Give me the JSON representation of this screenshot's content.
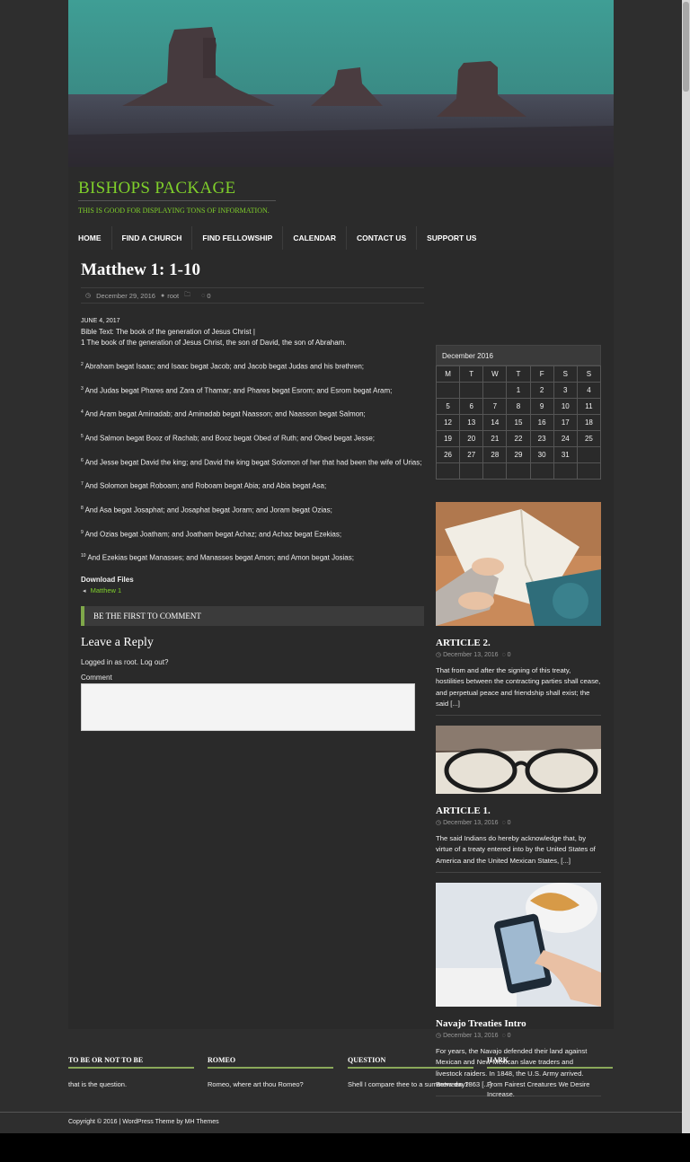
{
  "site": {
    "title": "BISHOPS PACKAGE",
    "tagline": "THIS IS GOOD FOR DISPLAYING TONS OF INFORMATION."
  },
  "nav": {
    "items": [
      {
        "label": "HOME"
      },
      {
        "label": "FIND A CHURCH"
      },
      {
        "label": "FIND FELLOWSHIP"
      },
      {
        "label": "CALENDAR"
      },
      {
        "label": "CONTACT US"
      },
      {
        "label": "SUPPORT US"
      }
    ]
  },
  "post": {
    "title": "Matthew 1: 1-10",
    "date": "December 29, 2016",
    "author": "root",
    "comments": "0",
    "entry_date": "JUNE 4, 2017",
    "bible_text": "Bible Text: The book of the generation of Jesus Christ |",
    "verses": [
      {
        "num": "",
        "text": "1 The book of the generation of Jesus Christ, the son of David, the son of Abraham."
      },
      {
        "num": "2",
        "text": " Abraham begat Isaac; and Isaac begat Jacob; and Jacob begat Judas and his brethren;"
      },
      {
        "num": "3",
        "text": " And Judas begat Phares and Zara of Thamar; and Phares begat Esrom; and Esrom begat Aram;"
      },
      {
        "num": "4",
        "text": " And Aram begat Aminadab; and Aminadab begat Naasson; and Naasson begat Salmon;"
      },
      {
        "num": "5",
        "text": " And Salmon begat Booz of Rachab; and Booz begat Obed of Ruth; and Obed begat Jesse;"
      },
      {
        "num": "6",
        "text": " And Jesse begat David the king; and David the king begat Solomon of her that had been the wife of Urias;"
      },
      {
        "num": "7",
        "text": " And Solomon begat Roboam; and Roboam begat Abia; and Abia begat Asa;"
      },
      {
        "num": "8",
        "text": " And Asa begat Josaphat; and Josaphat begat Joram; and Joram begat Ozias;"
      },
      {
        "num": "9",
        "text": " And Ozias begat Joatham; and Joatham begat Achaz; and Achaz begat Ezekias;"
      },
      {
        "num": "10",
        "text": " And Ezekias begat Manasses; and Manasses begat Amon; and Amon begat Josias;"
      }
    ],
    "download_title": "Download Files",
    "download_link": "Matthew 1",
    "download_icon": "speaker-icon"
  },
  "comments": {
    "first_label": "BE THE FIRST TO COMMENT",
    "leave_reply": "Leave a Reply",
    "logged_in": "Logged in as root. Log out?",
    "comment_label": "Comment"
  },
  "calendar": {
    "caption": "December 2016",
    "headers": [
      "M",
      "T",
      "W",
      "T",
      "F",
      "S",
      "S"
    ],
    "weeks": [
      [
        "",
        "",
        "",
        "1",
        "2",
        "3",
        "4"
      ],
      [
        "5",
        "6",
        "7",
        "8",
        "9",
        "10",
        "11"
      ],
      [
        "12",
        "13",
        "14",
        "15",
        "16",
        "17",
        "18"
      ],
      [
        "19",
        "20",
        "21",
        "22",
        "23",
        "24",
        "25"
      ],
      [
        "26",
        "27",
        "28",
        "29",
        "30",
        "31",
        ""
      ],
      [
        "",
        "",
        "",
        "",
        "",
        "",
        ""
      ]
    ]
  },
  "sidebar_posts": [
    {
      "title": "ARTICLE 2.",
      "date": "December 13, 2016",
      "comments": "0",
      "excerpt": "That from and after the signing of this treaty, hostilities between the contracting parties shall cease, and perpetual peace and friendship shall exist; the said [...]",
      "image": "open-bible-photo"
    },
    {
      "title": "ARTICLE 1.",
      "date": "December 13, 2016",
      "comments": "0",
      "excerpt": "The said Indians do hereby acknowledge that, by virtue of a treaty entered into by the United States of America and the United Mexican States, [...]",
      "image": "glasses-on-book-photo"
    },
    {
      "title": "Navajo Treaties Intro",
      "date": "December 13, 2016",
      "comments": "0",
      "excerpt": "For years, the Navajo defended their land against Mexican and New Mexican slave traders and livestock raiders. In 1848, the U.S. Army arrived. Between 1863 [...]",
      "image": "phone-in-hand-photo"
    }
  ],
  "footer_widgets": [
    {
      "title": "TO BE OR NOT TO BE",
      "text": "that is the question."
    },
    {
      "title": "ROMEO",
      "text": "Romeo, where art thou Romeo?"
    },
    {
      "title": "QUESTION",
      "text": "Shell I compare thee to a summers day?"
    },
    {
      "title": "HARK",
      "text": "From Fairest Creatures We Desire Increase."
    }
  ],
  "copyright": "Copyright © 2016 | WordPress Theme by MH Themes",
  "colors": {
    "accent": "#7fcf2b",
    "background": "#2e2e2e",
    "content_bg": "#2a2a2a",
    "comment_bar_border": "#7fa84a"
  }
}
